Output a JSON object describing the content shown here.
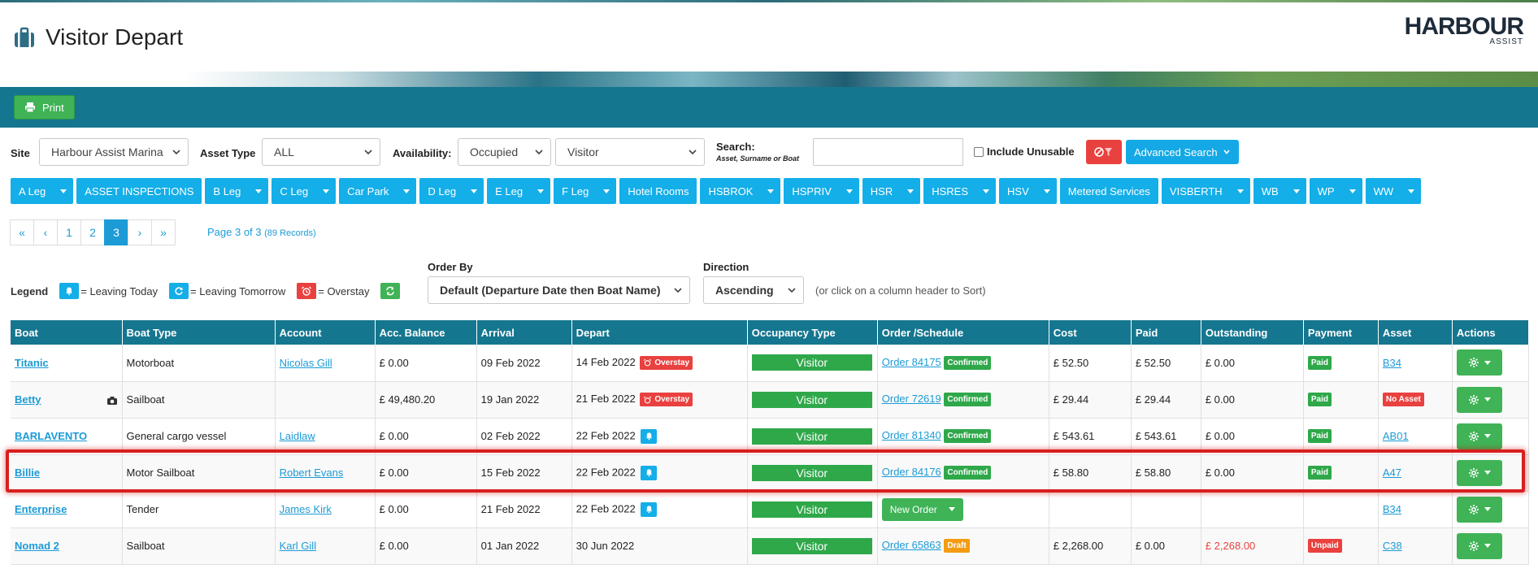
{
  "header": {
    "title": "Visitor Depart",
    "logo_word": "HARBOUR",
    "logo_sub": "ASSIST"
  },
  "toolbar": {
    "print_label": "Print"
  },
  "filters": {
    "site_label": "Site",
    "site_value": "Harbour Assist Marina",
    "asset_type_label": "Asset Type",
    "asset_type_value": "ALL",
    "availability_label": "Availability:",
    "availability_value": "Occupied",
    "category_value": "Visitor",
    "search_label": "Search:",
    "search_hint": "Asset, Surname or Boat",
    "search_value": "",
    "include_unusable_label": "Include Unusable",
    "advanced_search_label": "Advanced Search"
  },
  "docks": [
    "A Leg",
    "ASSET INSPECTIONS",
    "B Leg",
    "C Leg",
    "Car Park",
    "D Leg",
    "E Leg",
    "F Leg",
    "Hotel Rooms",
    "HSBROK",
    "HSPRIV",
    "HSR",
    "HSRES",
    "HSV",
    "Metered Services",
    "VISBERTH",
    "WB",
    "WP",
    "WW"
  ],
  "pagination": {
    "pages": [
      "«",
      "‹",
      "1",
      "2",
      "3",
      "›",
      "»"
    ],
    "active": "3",
    "info": "Page 3 of 3",
    "records": "(89 Records)"
  },
  "legend": {
    "title": "Legend",
    "leaving_today": "= Leaving Today",
    "leaving_tomorrow": "= Leaving Tomorrow",
    "overstay": "= Overstay"
  },
  "order_by": {
    "label": "Order By",
    "value": "Default (Departure Date then Boat Name)"
  },
  "direction": {
    "label": "Direction",
    "value": "Ascending"
  },
  "sort_hint": "(or click on a column header to Sort)",
  "table": {
    "headers": [
      "Boat",
      "Boat Type",
      "Account",
      "Acc. Balance",
      "Arrival",
      "Depart",
      "Occupancy Type",
      "Order /Schedule",
      "Cost",
      "Paid",
      "Outstanding",
      "Payment",
      "Asset",
      "Actions"
    ],
    "rows": [
      {
        "boat": "Titanic",
        "type": "Motorboat",
        "account": "Nicolas Gill",
        "balance": "£ 0.00",
        "arrival": "09 Feb 2022",
        "depart": "14 Feb 2022",
        "flag": "Overstay",
        "occ": "Visitor",
        "order": "Order 84175",
        "status": "Confirmed",
        "cost": "£ 52.50",
        "paid": "£ 52.50",
        "outstanding": "£ 0.00",
        "payment": "Paid",
        "asset": "B34"
      },
      {
        "boat": "Betty",
        "type": "Sailboat",
        "account": "",
        "balance": "£ 49,480.20",
        "arrival": "19 Jan 2022",
        "depart": "21 Feb 2022",
        "flag": "Overstay",
        "occ": "Visitor",
        "order": "Order 72619",
        "status": "Confirmed",
        "cost": "£ 29.44",
        "paid": "£ 29.44",
        "outstanding": "£ 0.00",
        "payment": "Paid",
        "asset": "No Asset"
      },
      {
        "boat": "BARLAVENTO",
        "type": "General cargo vessel",
        "account": "Laidlaw",
        "balance": "£ 0.00",
        "arrival": "02 Feb 2022",
        "depart": "22 Feb 2022",
        "flag": "",
        "occ": "Visitor",
        "order": "Order 81340",
        "status": "Confirmed",
        "cost": "£ 543.61",
        "paid": "£ 543.61",
        "outstanding": "£ 0.00",
        "payment": "Paid",
        "asset": "AB01"
      },
      {
        "boat": "Billie",
        "type": "Motor Sailboat",
        "account": "Robert Evans",
        "balance": "£ 0.00",
        "arrival": "15 Feb 2022",
        "depart": "22 Feb 2022",
        "flag": "",
        "occ": "Visitor",
        "order": "Order 84176",
        "status": "Confirmed",
        "cost": "£ 58.80",
        "paid": "£ 58.80",
        "outstanding": "£ 0.00",
        "payment": "Paid",
        "asset": "A47"
      },
      {
        "boat": "Enterprise",
        "type": "Tender",
        "account": "James Kirk",
        "balance": "£ 0.00",
        "arrival": "21 Feb 2022",
        "depart": "22 Feb 2022",
        "flag": "",
        "occ": "Visitor",
        "order": "",
        "status": "",
        "new_order": "New Order",
        "cost": "",
        "paid": "",
        "outstanding": "",
        "payment": "",
        "asset": "B34"
      },
      {
        "boat": "Nomad 2",
        "type": "Sailboat",
        "account": "Karl Gill",
        "balance": "£ 0.00",
        "arrival": "01 Jan 2022",
        "depart": "30 Jun 2022",
        "flag": "",
        "occ": "Visitor",
        "order": "Order 65863",
        "status": "Draft",
        "cost": "£ 2,268.00",
        "paid": "£ 0.00",
        "outstanding": "£ 2,268.00",
        "payment": "Unpaid",
        "asset": "C38"
      }
    ]
  },
  "colors": {
    "teal": "#15768f",
    "blue": "#14aee8",
    "green": "#3fb356",
    "red": "#e9413f",
    "orange": "#f39c12"
  }
}
